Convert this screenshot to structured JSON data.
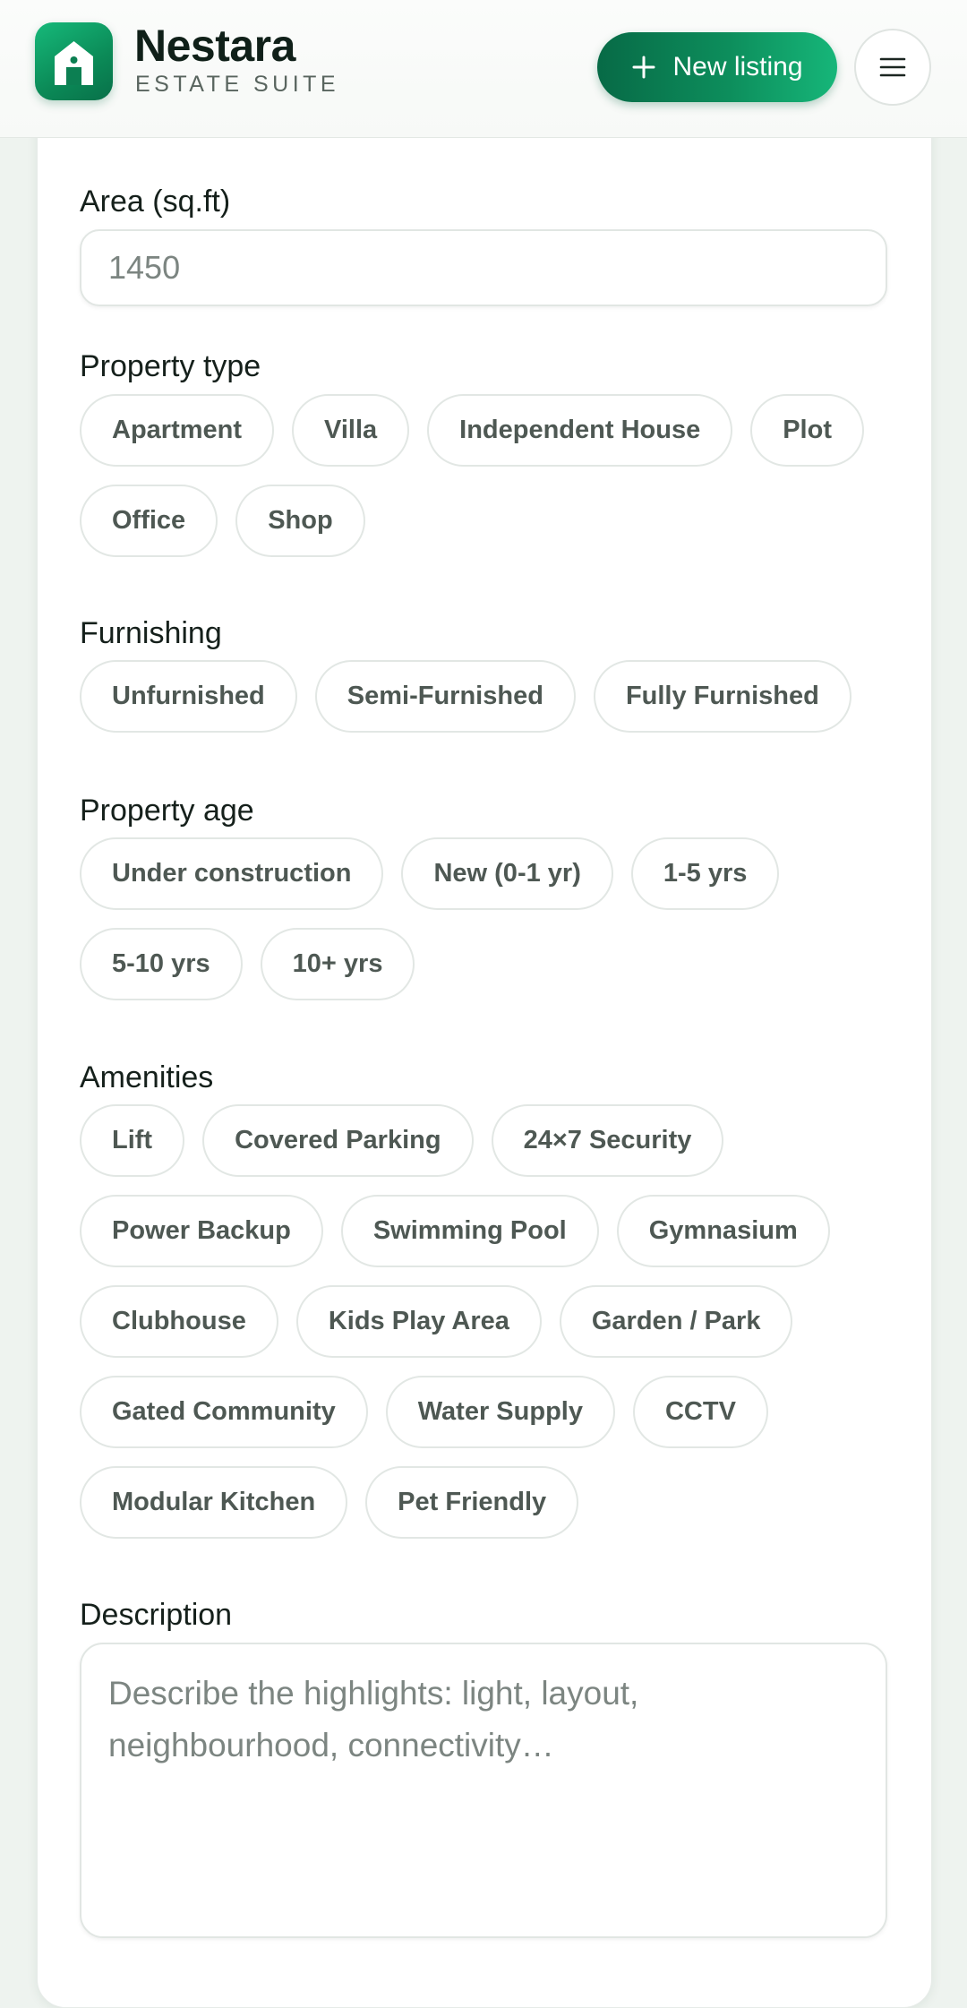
{
  "header": {
    "brand_name": "Nestara",
    "brand_sub": "ESTATE SUITE",
    "new_listing_label": "New listing",
    "logo_icon": "house-icon",
    "menu_icon": "hamburger-menu-icon",
    "accent_color": "#0d8e5c"
  },
  "form": {
    "area": {
      "label": "Area (sq.ft)",
      "placeholder": "1450"
    },
    "property_type": {
      "label": "Property type",
      "options": [
        "Apartment",
        "Villa",
        "Independent House",
        "Plot",
        "Office",
        "Shop"
      ]
    },
    "furnishing": {
      "label": "Furnishing",
      "options": [
        "Unfurnished",
        "Semi-Furnished",
        "Fully Furnished"
      ]
    },
    "property_age": {
      "label": "Property age",
      "options": [
        "Under construction",
        "New (0-1 yr)",
        "1-5 yrs",
        "5-10 yrs",
        "10+ yrs"
      ]
    },
    "amenities": {
      "label": "Amenities",
      "options": [
        "Lift",
        "Covered Parking",
        "24×7 Security",
        "Power Backup",
        "Swimming Pool",
        "Gymnasium",
        "Clubhouse",
        "Kids Play Area",
        "Garden / Park",
        "Gated Community",
        "Water Supply",
        "CCTV",
        "Modular Kitchen",
        "Pet Friendly"
      ]
    },
    "description": {
      "label": "Description",
      "placeholder": "Describe the highlights: light, layout, neighbourhood, connectivity…"
    }
  }
}
